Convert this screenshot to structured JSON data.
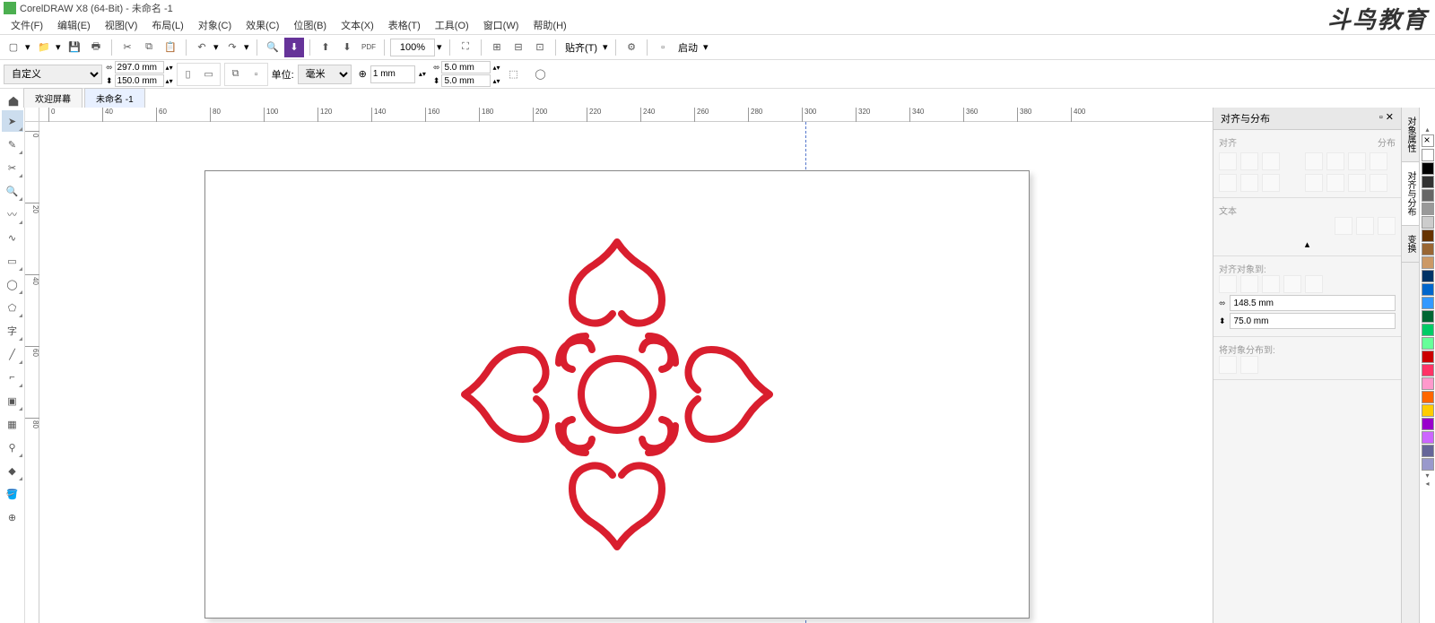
{
  "app": {
    "title": "CorelDRAW X8 (64-Bit) - 未命名 -1",
    "watermark": "斗鸟教育"
  },
  "menu": {
    "items": [
      "文件(F)",
      "编辑(E)",
      "视图(V)",
      "布局(L)",
      "对象(C)",
      "效果(C)",
      "位图(B)",
      "文本(X)",
      "表格(T)",
      "工具(O)",
      "窗口(W)",
      "帮助(H)"
    ]
  },
  "toolbar": {
    "zoom": "100%",
    "snap_label": "贴齐(T)",
    "launch_label": "启动"
  },
  "property": {
    "preset": "自定义",
    "width": "297.0 mm",
    "height": "150.0 mm",
    "units_label": "单位:",
    "units": "毫米",
    "nudge": "1 mm",
    "dup_x": "5.0 mm",
    "dup_y": "5.0 mm"
  },
  "tabs": {
    "welcome": "欢迎屏幕",
    "doc1": "未命名 -1"
  },
  "ruler": {
    "h_ticks": [
      "0",
      "40",
      "60",
      "80",
      "100",
      "120",
      "140",
      "160",
      "180",
      "200",
      "220",
      "240",
      "260",
      "280",
      "300",
      "320",
      "340",
      "360",
      "380",
      "400"
    ],
    "v_ticks": [
      "0",
      "20",
      "40",
      "60",
      "80"
    ]
  },
  "docker": {
    "title": "对齐与分布",
    "section1": "对齐",
    "section2": "分布",
    "section3": "文本",
    "section4": "对齐对象到:",
    "x_value": "148.5 mm",
    "y_value": "75.0 mm",
    "section5": "将对象分布到:",
    "tabs": [
      "对象属性",
      "对齐与分布",
      "变换"
    ]
  },
  "colors": [
    "#ffffff",
    "#000000",
    "#333333",
    "#666666",
    "#999999",
    "#cccccc",
    "#663300",
    "#996633",
    "#cc9966",
    "#003366",
    "#0066cc",
    "#3399ff",
    "#006633",
    "#00cc66",
    "#66ff99",
    "#cc0000",
    "#ff3366",
    "#ff99cc",
    "#ff6600",
    "#ffcc00",
    "#9900cc",
    "#cc66ff",
    "#666699",
    "#9999cc"
  ]
}
